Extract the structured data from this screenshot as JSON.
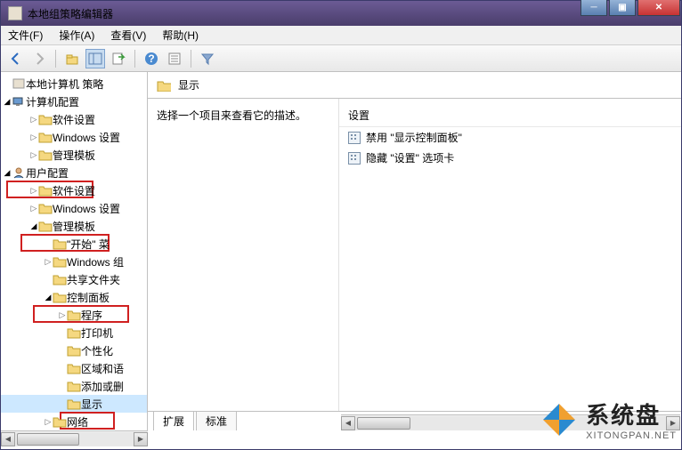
{
  "window": {
    "title": "本地组策略编辑器"
  },
  "menu": {
    "file": "文件(F)",
    "action": "操作(A)",
    "view": "查看(V)",
    "help": "帮助(H)"
  },
  "tree": {
    "root": "本地计算机 策略",
    "computer_config": "计算机配置",
    "cc_software": "软件设置",
    "cc_windows": "Windows 设置",
    "cc_admin": "管理模板",
    "user_config": "用户配置",
    "uc_software": "软件设置",
    "uc_windows": "Windows 设置",
    "uc_admin": "管理模板",
    "uc_start": "\"开始\" 菜",
    "uc_wincomp": "Windows 组",
    "uc_shared": "共享文件夹",
    "uc_cpl": "控制面板",
    "uc_prog": "程序",
    "uc_print": "打印机",
    "uc_personal": "个性化",
    "uc_region": "区域和语",
    "uc_addrem": "添加或删",
    "uc_display": "显示",
    "uc_network": "网络"
  },
  "right": {
    "header": "显示",
    "desc_prompt": "选择一个项目来查看它的描述。",
    "settings_col": "设置",
    "items": {
      "i0": "禁用 \"显示控制面板\"",
      "i1": "隐藏 \"设置\" 选项卡"
    }
  },
  "tabs": {
    "extended": "扩展",
    "standard": "标准"
  },
  "logo": {
    "cn": "系统盘",
    "en": "XITONGPAN.NET"
  }
}
